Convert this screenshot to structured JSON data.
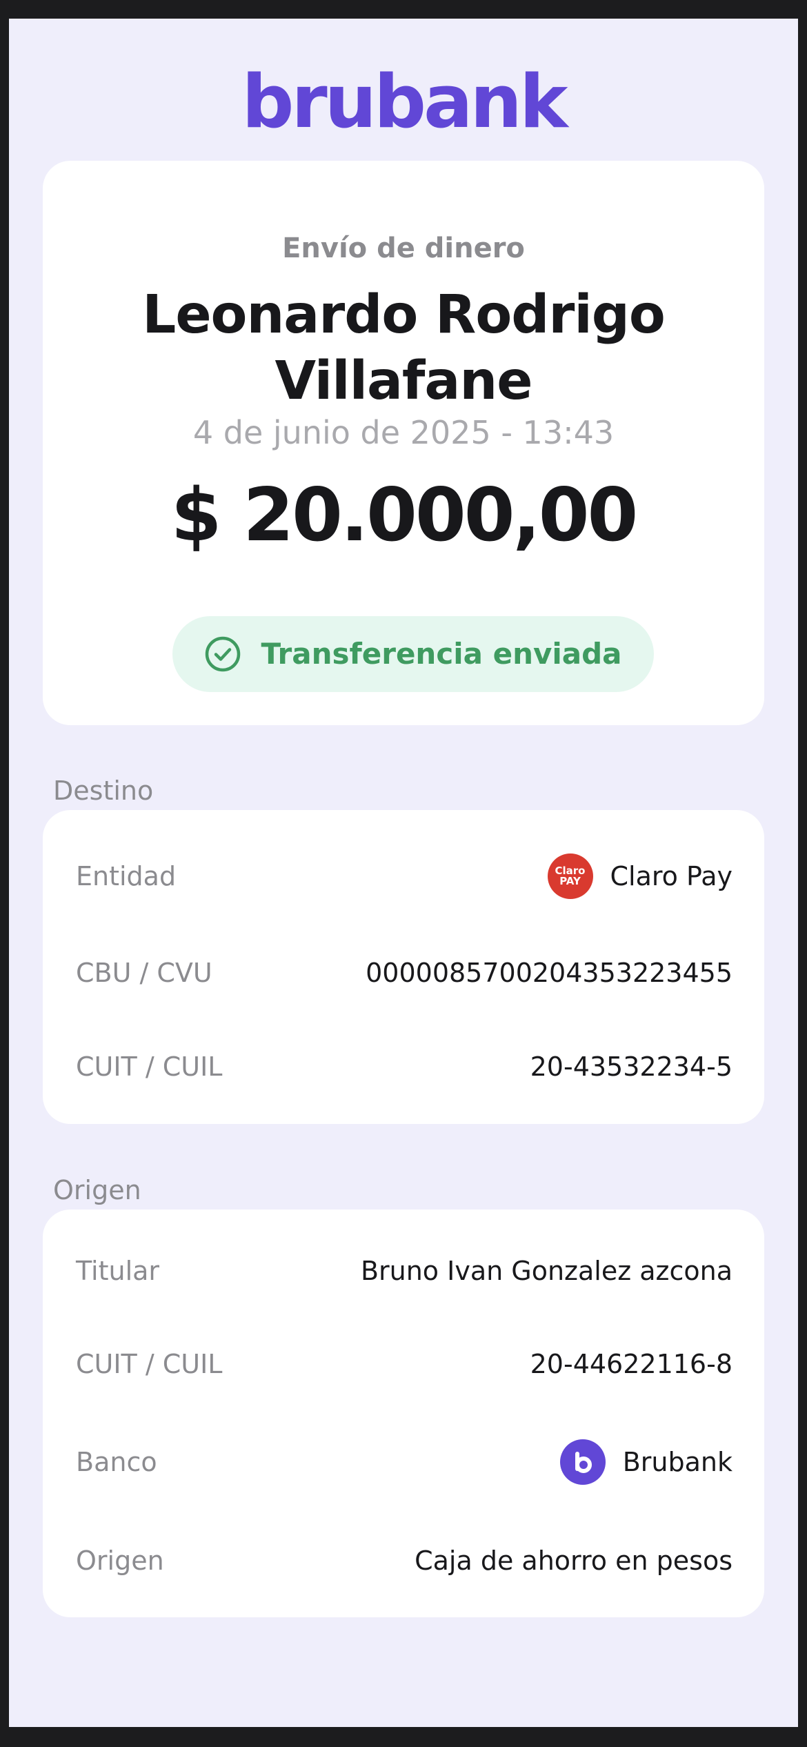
{
  "brand": {
    "logo_text": "brubank",
    "color": "#6147d6"
  },
  "summary": {
    "kind": "Envío de dinero",
    "recipient_line1": "Leonardo Rodrigo",
    "recipient_line2": "Villafane",
    "datetime": "4 de junio de 2025 - 13:43",
    "amount": "$ 20.000,00",
    "status": {
      "label": "Transferencia enviada",
      "icon": "check-circle-icon",
      "color": "#3f9b60",
      "background": "#e5f7ef"
    }
  },
  "destination": {
    "section_title": "Destino",
    "rows": [
      {
        "label": "Entidad",
        "value": "Claro Pay",
        "icon": "claro-pay-logo"
      },
      {
        "label": "CBU / CVU",
        "value": "0000085700204353223455"
      },
      {
        "label": "CUIT / CUIL",
        "value": "20-43532234-5"
      }
    ],
    "claro_logo_text_top": "Claro",
    "claro_logo_text_bottom": "PAY",
    "claro_color": "#d93a2f"
  },
  "origin": {
    "section_title": "Origen",
    "rows": [
      {
        "label": "Titular",
        "value": "Bruno Ivan Gonzalez azcona"
      },
      {
        "label": "CUIT / CUIL",
        "value": "20-44622116-8"
      },
      {
        "label": "Banco",
        "value": "Brubank",
        "icon": "brubank-logo"
      },
      {
        "label": "Origen",
        "value": "Caja de ahorro en pesos"
      }
    ]
  }
}
